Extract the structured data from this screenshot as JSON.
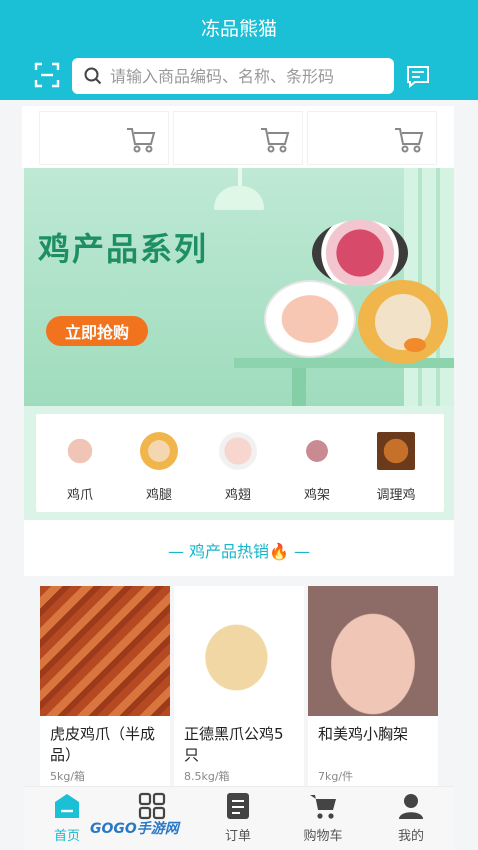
{
  "header": {
    "title": "冻品熊猫",
    "search_placeholder": "请输入商品编码、名称、条形码",
    "scan_icon": "scan-icon",
    "message_icon": "message-icon"
  },
  "cart_row": {
    "icon": "cart-icon",
    "cells": 3
  },
  "banner": {
    "title": "鸡产品系列",
    "button": "立即抢购",
    "accent": "#1d8f62",
    "button_color": "#f2731e"
  },
  "categories": [
    {
      "label": "鸡爪"
    },
    {
      "label": "鸡腿"
    },
    {
      "label": "鸡翅"
    },
    {
      "label": "鸡架"
    },
    {
      "label": "调理鸡"
    }
  ],
  "hot_section": {
    "title": "— 鸡产品热销",
    "fire": "🔥",
    "trail": " —"
  },
  "products": [
    {
      "name": "虎皮鸡爪（半成品）",
      "spec": "5kg/箱"
    },
    {
      "name": "正德黑爪公鸡5只",
      "spec": "8.5kg/箱"
    },
    {
      "name": "和美鸡小胸架",
      "spec": "7kg/件"
    }
  ],
  "tabbar": {
    "items": [
      {
        "label": "首页",
        "icon": "home-icon",
        "active": true
      },
      {
        "label": "",
        "icon": "category-icon",
        "active": false
      },
      {
        "label": "订单",
        "icon": "order-icon",
        "active": false
      },
      {
        "label": "购物车",
        "icon": "cart-icon",
        "active": false
      },
      {
        "label": "我的",
        "icon": "profile-icon",
        "active": false
      }
    ]
  },
  "watermark": "GOGO手游网",
  "colors": {
    "primary": "#1cc0d6",
    "tab_active": "#1cb8cc"
  }
}
